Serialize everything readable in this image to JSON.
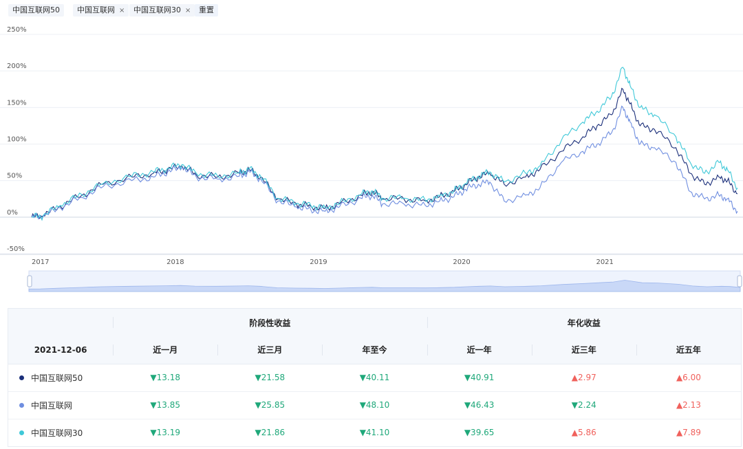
{
  "tags": [
    {
      "label": "中国互联网50",
      "closable": false
    },
    {
      "label": "中国互联网",
      "closable": true
    },
    {
      "label": "中国互联网30",
      "closable": true
    }
  ],
  "close_glyph": "×",
  "reset_label": "重置",
  "chart_data": {
    "type": "line",
    "title": "",
    "xlabel": "",
    "ylabel": "",
    "ylim": [
      -50,
      250
    ],
    "yticks": [
      -50,
      0,
      50,
      100,
      150,
      200,
      250
    ],
    "ytick_labels": [
      "-50%",
      "0%",
      "50%",
      "100%",
      "150%",
      "200%",
      "250%"
    ],
    "xlim": [
      2017.0,
      2021.93
    ],
    "xticks": [
      2017,
      2018,
      2019,
      2020,
      2021
    ],
    "xtick_labels": [
      "2017",
      "2018",
      "2019",
      "2020",
      "2021"
    ],
    "grid": "horizontal",
    "series": [
      {
        "name": "中国互联网50",
        "color": "#1b2f7a",
        "x": [
          2017.0,
          2017.08,
          2017.2,
          2017.35,
          2017.5,
          2017.7,
          2017.85,
          2017.95,
          2018.05,
          2018.15,
          2018.3,
          2018.45,
          2018.52,
          2018.6,
          2018.72,
          2018.85,
          2018.95,
          2019.05,
          2019.15,
          2019.3,
          2019.38,
          2019.45,
          2019.6,
          2019.75,
          2019.85,
          2019.95,
          2020.03,
          2020.12,
          2020.2,
          2020.3,
          2020.45,
          2020.55,
          2020.7,
          2020.85,
          2020.95,
          2021.05,
          2021.13,
          2021.18,
          2021.25,
          2021.35,
          2021.5,
          2021.6,
          2021.7,
          2021.8,
          2021.86,
          2021.93
        ],
        "y": [
          0,
          2,
          15,
          30,
          45,
          55,
          60,
          65,
          70,
          58,
          55,
          60,
          65,
          55,
          25,
          18,
          15,
          12,
          18,
          30,
          35,
          25,
          25,
          22,
          28,
          35,
          45,
          55,
          60,
          45,
          55,
          65,
          90,
          110,
          125,
          140,
          175,
          155,
          125,
          120,
          95,
          60,
          45,
          55,
          50,
          32
        ]
      },
      {
        "name": "中国互联网",
        "color": "#6f8ee0",
        "x": [
          2017.0,
          2017.08,
          2017.2,
          2017.35,
          2017.5,
          2017.7,
          2017.85,
          2017.95,
          2018.05,
          2018.15,
          2018.3,
          2018.45,
          2018.52,
          2018.6,
          2018.72,
          2018.85,
          2018.95,
          2019.05,
          2019.15,
          2019.3,
          2019.38,
          2019.45,
          2019.6,
          2019.75,
          2019.85,
          2019.95,
          2020.03,
          2020.12,
          2020.2,
          2020.3,
          2020.45,
          2020.55,
          2020.7,
          2020.85,
          2020.95,
          2021.05,
          2021.13,
          2021.18,
          2021.25,
          2021.35,
          2021.5,
          2021.6,
          2021.7,
          2021.8,
          2021.86,
          2021.93
        ],
        "y": [
          0,
          1,
          13,
          27,
          42,
          50,
          55,
          62,
          68,
          55,
          52,
          56,
          62,
          52,
          22,
          14,
          10,
          8,
          14,
          26,
          30,
          18,
          18,
          16,
          22,
          28,
          38,
          45,
          48,
          22,
          30,
          40,
          75,
          90,
          100,
          115,
          150,
          130,
          100,
          95,
          75,
          35,
          25,
          30,
          25,
          8
        ]
      },
      {
        "name": "中国互联网30",
        "color": "#3fc8d8",
        "x": [
          2017.0,
          2017.08,
          2017.2,
          2017.35,
          2017.5,
          2017.7,
          2017.85,
          2017.95,
          2018.05,
          2018.15,
          2018.3,
          2018.45,
          2018.52,
          2018.6,
          2018.72,
          2018.85,
          2018.95,
          2019.05,
          2019.15,
          2019.3,
          2019.38,
          2019.45,
          2019.6,
          2019.75,
          2019.85,
          2019.95,
          2020.03,
          2020.12,
          2020.2,
          2020.3,
          2020.45,
          2020.55,
          2020.7,
          2020.85,
          2020.95,
          2021.05,
          2021.13,
          2021.18,
          2021.25,
          2021.35,
          2021.5,
          2021.6,
          2021.7,
          2021.8,
          2021.86,
          2021.93
        ],
        "y": [
          0,
          2,
          16,
          31,
          46,
          56,
          62,
          67,
          72,
          60,
          56,
          61,
          66,
          56,
          26,
          19,
          16,
          13,
          19,
          31,
          36,
          26,
          26,
          23,
          29,
          36,
          46,
          56,
          62,
          48,
          60,
          70,
          105,
          130,
          145,
          165,
          205,
          180,
          150,
          140,
          110,
          75,
          60,
          75,
          65,
          40
        ]
      }
    ]
  },
  "table": {
    "group_headers": [
      "阶段性收益",
      "年化收益"
    ],
    "date": "2021-12-06",
    "columns": [
      "近一月",
      "近三月",
      "年至今",
      "近一年",
      "近三年",
      "近五年"
    ],
    "rows": [
      {
        "name": "中国互联网50",
        "color": "#1b2f7a",
        "values": [
          {
            "text": "▼13.18",
            "dir": "down"
          },
          {
            "text": "▼21.58",
            "dir": "down"
          },
          {
            "text": "▼40.11",
            "dir": "down"
          },
          {
            "text": "▼40.91",
            "dir": "down"
          },
          {
            "text": "▲2.97",
            "dir": "up"
          },
          {
            "text": "▲6.00",
            "dir": "up"
          }
        ]
      },
      {
        "name": "中国互联网",
        "color": "#6f8ee0",
        "values": [
          {
            "text": "▼13.85",
            "dir": "down"
          },
          {
            "text": "▼25.85",
            "dir": "down"
          },
          {
            "text": "▼48.10",
            "dir": "down"
          },
          {
            "text": "▼46.43",
            "dir": "down"
          },
          {
            "text": "▼2.24",
            "dir": "down"
          },
          {
            "text": "▲2.13",
            "dir": "up"
          }
        ]
      },
      {
        "name": "中国互联网30",
        "color": "#3fc8d8",
        "values": [
          {
            "text": "▼13.19",
            "dir": "down"
          },
          {
            "text": "▼21.86",
            "dir": "down"
          },
          {
            "text": "▼41.10",
            "dir": "down"
          },
          {
            "text": "▼39.65",
            "dir": "down"
          },
          {
            "text": "▲5.86",
            "dir": "up"
          },
          {
            "text": "▲7.89",
            "dir": "up"
          }
        ]
      }
    ]
  }
}
